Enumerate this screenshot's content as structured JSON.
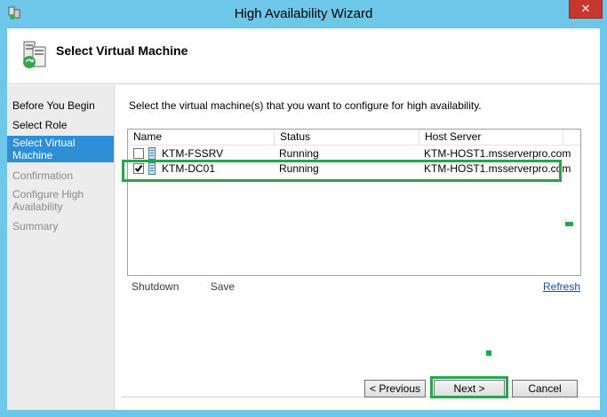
{
  "window": {
    "title": "High Availability Wizard",
    "close_glyph": "✕"
  },
  "header": {
    "title": "Select Virtual Machine"
  },
  "nav": {
    "items": [
      {
        "label": "Before You Begin",
        "state": "normal"
      },
      {
        "label": "Select Role",
        "state": "normal"
      },
      {
        "label": "Select Virtual Machine",
        "state": "active"
      },
      {
        "label": "Confirmation",
        "state": "disabled"
      },
      {
        "label": "Configure High Availability",
        "state": "disabled"
      },
      {
        "label": "Summary",
        "state": "disabled"
      }
    ]
  },
  "content": {
    "instruction": "Select the virtual machine(s) that you want to configure for high availability."
  },
  "table": {
    "columns": [
      "Name",
      "Status",
      "Host Server"
    ],
    "rows": [
      {
        "checked": false,
        "name": "KTM-FSSRV",
        "status": "Running",
        "host": "KTM-HOST1.msserverpro.com"
      },
      {
        "checked": true,
        "name": "KTM-DC01",
        "status": "Running",
        "host": "KTM-HOST1.msserverpro.com"
      }
    ]
  },
  "actions": {
    "shutdown": "Shutdown",
    "save": "Save",
    "refresh": "Refresh"
  },
  "buttons": {
    "previous": "< Previous",
    "next": "Next >",
    "cancel": "Cancel"
  },
  "colors": {
    "titlebar": "#6ec6e8",
    "nav_active": "#2d8fd5",
    "highlight": "#22a84b",
    "close": "#c8372e"
  }
}
